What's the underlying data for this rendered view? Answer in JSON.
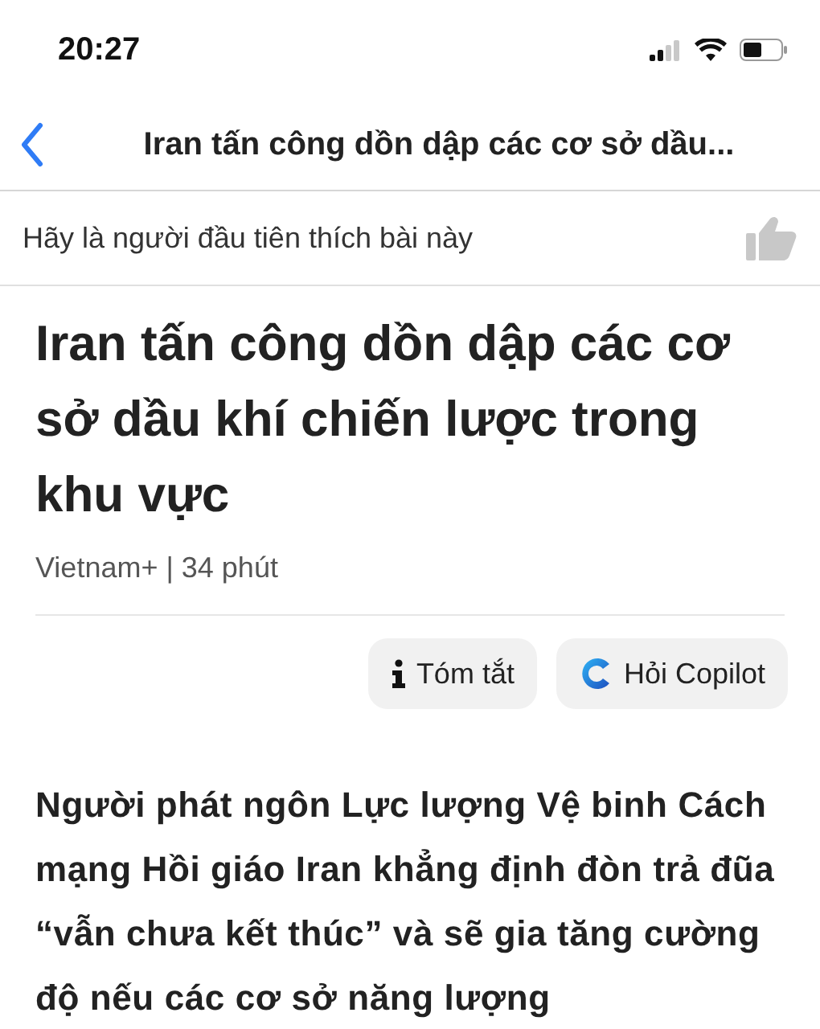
{
  "status_bar": {
    "time": "20:27"
  },
  "nav_bar": {
    "title": "Iran tấn công dồn dập các cơ sở dầu..."
  },
  "like_bar": {
    "text": "Hãy là người đầu tiên thích bài này"
  },
  "article": {
    "title": "Iran tấn công dồn dập các cơ sở dầu khí chiến lược trong khu vực",
    "meta": "Vietnam+ | 34 phút",
    "actions": [
      {
        "kind": "info",
        "label": "Tóm tắt"
      },
      {
        "kind": "copilot",
        "label": "Hỏi Copilot"
      }
    ],
    "lead": "Người phát ngôn Lực lượng Vệ binh Cách mạng Hồi giáo Iran khẳng định đòn trả đũa “vẫn chưa kết thúc” và sẽ gia tăng cường độ nếu các cơ sở năng lượng"
  }
}
